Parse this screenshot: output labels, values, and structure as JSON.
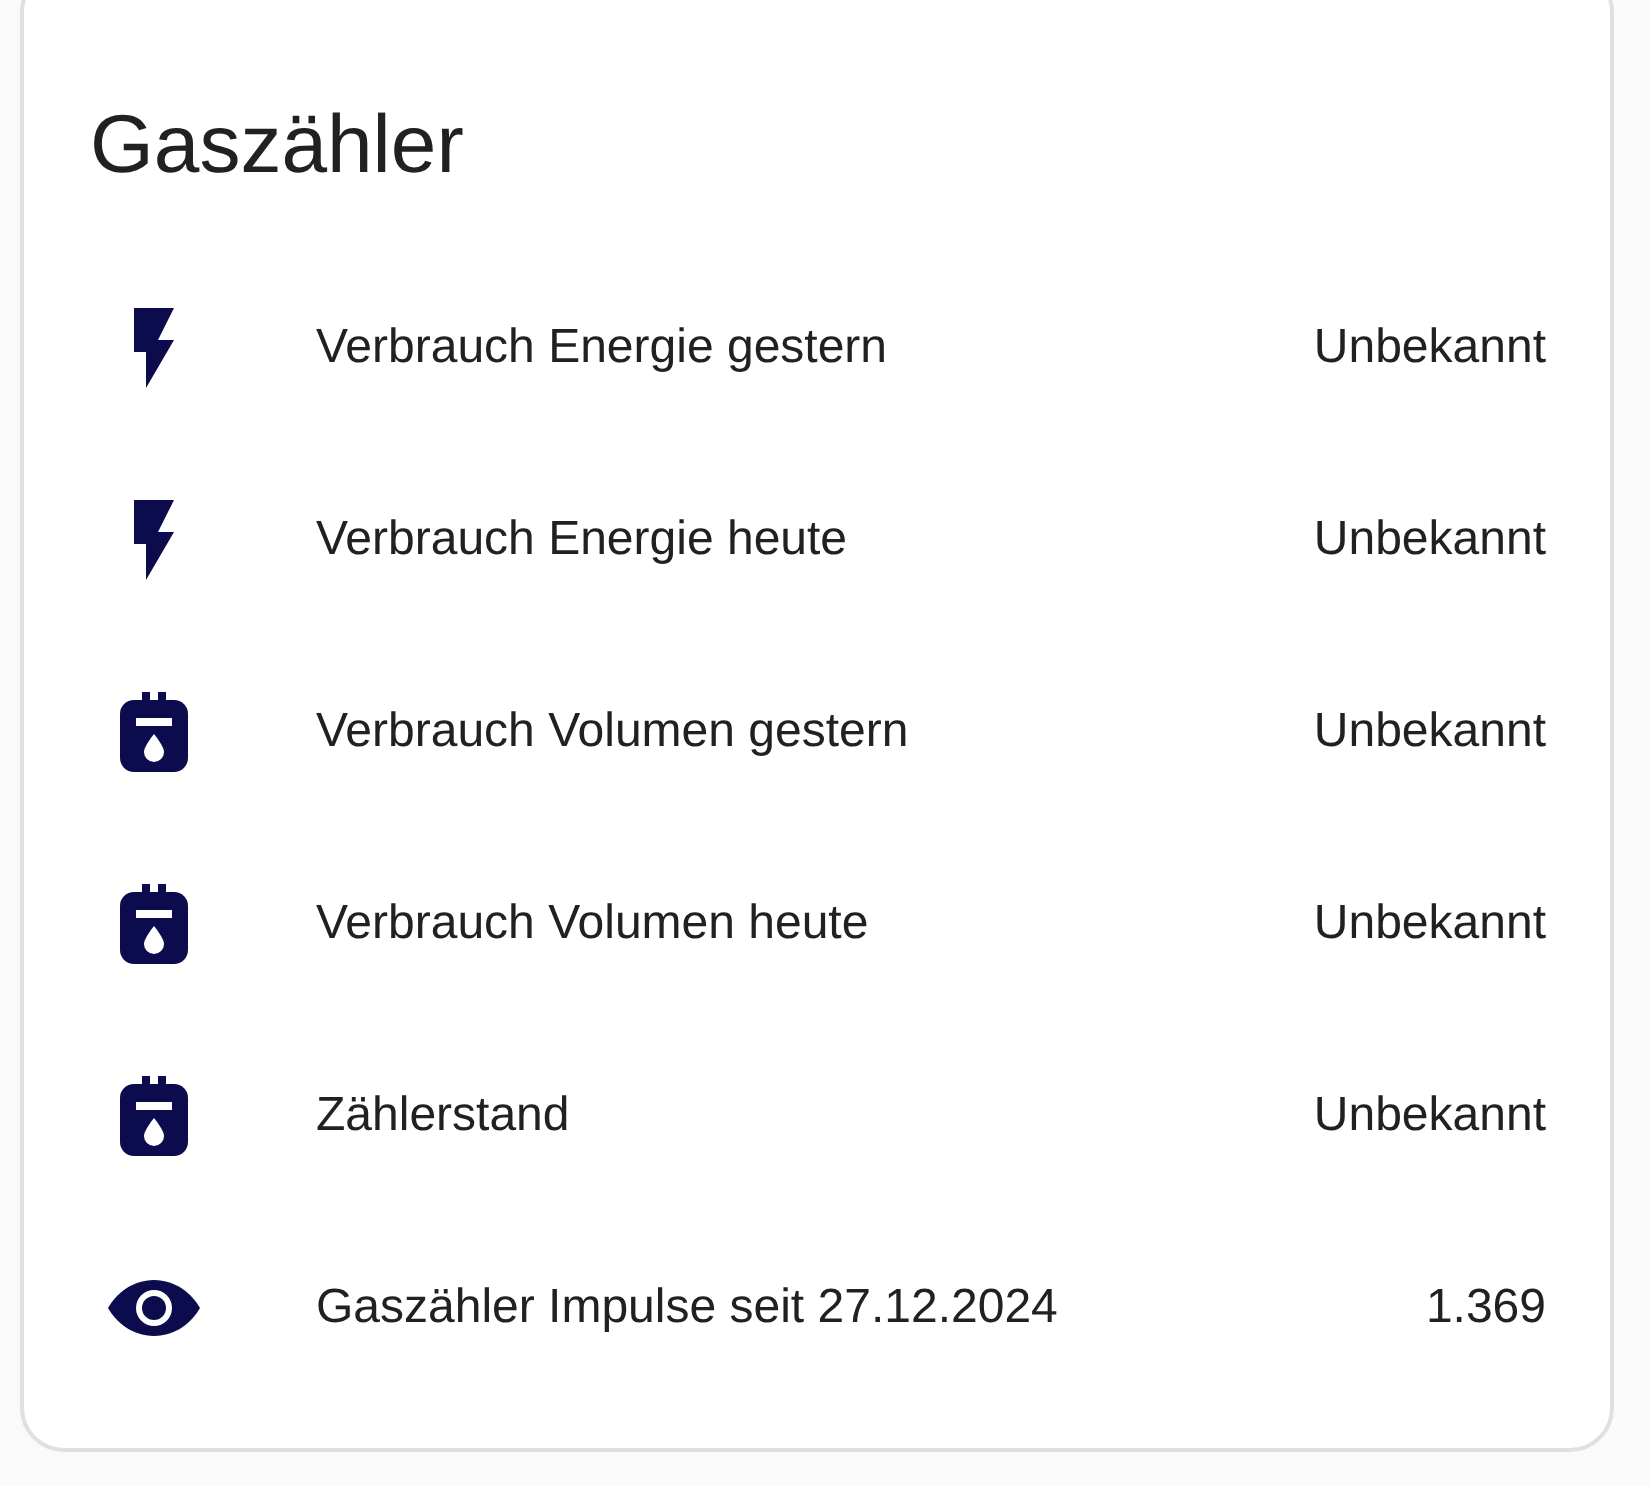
{
  "card": {
    "title": "Gaszähler",
    "rows": [
      {
        "kind": "energy",
        "name": "Verbrauch Energie gestern",
        "value": "Unbekannt"
      },
      {
        "kind": "energy",
        "name": "Verbrauch Energie heute",
        "value": "Unbekannt"
      },
      {
        "kind": "meter",
        "name": "Verbrauch Volumen gestern",
        "value": "Unbekannt"
      },
      {
        "kind": "meter",
        "name": "Verbrauch Volumen heute",
        "value": "Unbekannt"
      },
      {
        "kind": "meter",
        "name": "Zählerstand",
        "value": "Unbekannt"
      },
      {
        "kind": "eye",
        "name": "Gaszähler Impulse seit 27.12.2024",
        "value": "1.369"
      }
    ]
  }
}
